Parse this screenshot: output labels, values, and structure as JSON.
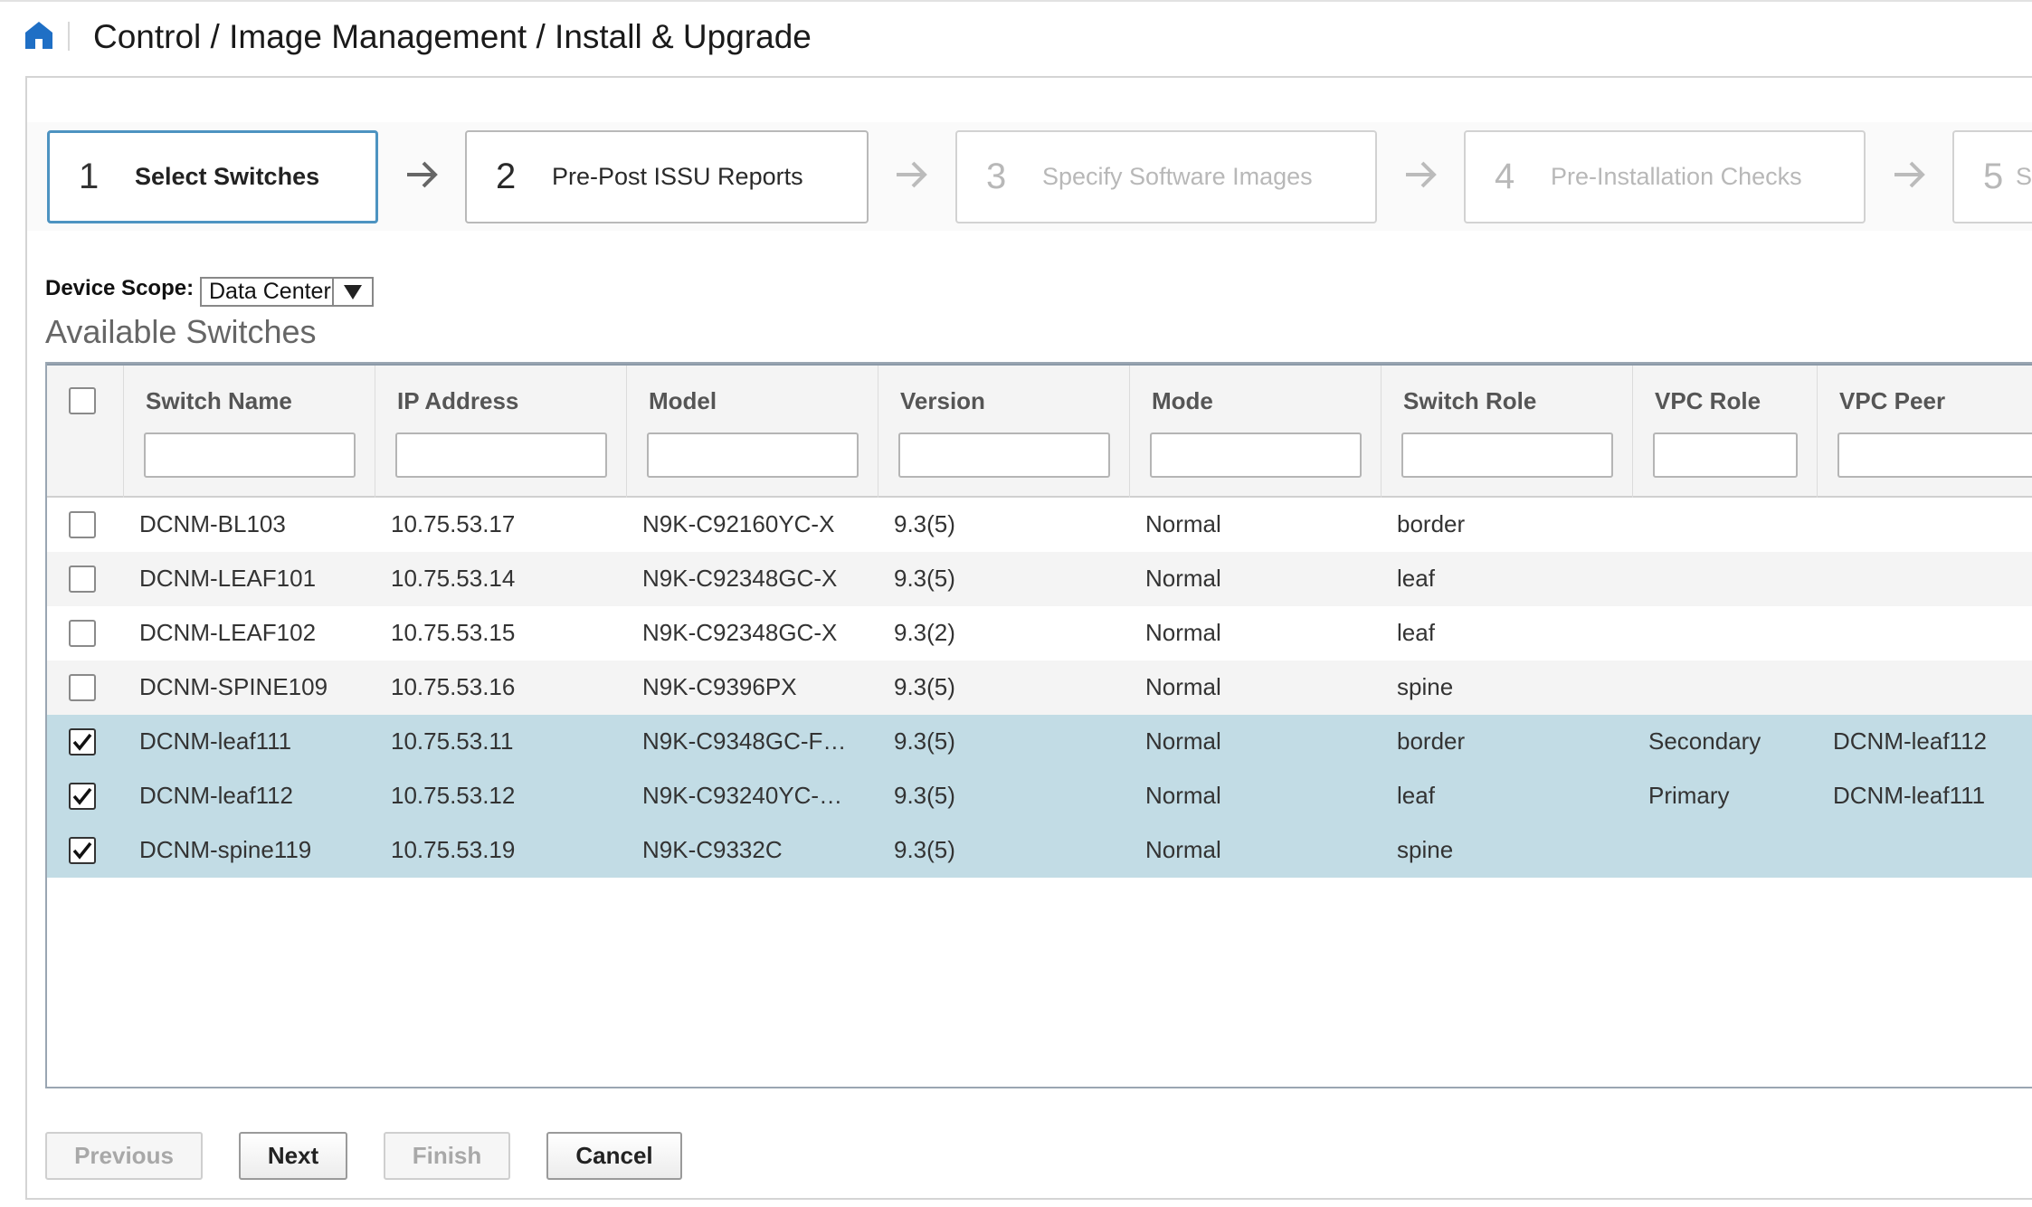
{
  "header": {
    "breadcrumb": "Control / Image Management / Install & Upgrade"
  },
  "wizard": {
    "steps": [
      {
        "num": "1",
        "label": "Select Switches",
        "state": "active"
      },
      {
        "num": "2",
        "label": "Pre-Post ISSU Reports",
        "state": "enabled"
      },
      {
        "num": "3",
        "label": "Specify Software Images",
        "state": "disabled"
      },
      {
        "num": "4",
        "label": "Pre-Installation Checks",
        "state": "disabled"
      },
      {
        "num": "5",
        "label": "S",
        "state": "disabled"
      }
    ]
  },
  "scope": {
    "label": "Device Scope:",
    "value": "Data Center"
  },
  "section_title": "Available Switches",
  "table": {
    "columns": [
      "Switch Name",
      "IP Address",
      "Model",
      "Version",
      "Mode",
      "Switch Role",
      "VPC Role",
      "VPC Peer"
    ],
    "rows": [
      {
        "checked": false,
        "name": "DCNM-BL103",
        "ip": "10.75.53.17",
        "model": "N9K-C92160YC-X",
        "version": "9.3(5)",
        "mode": "Normal",
        "role": "border",
        "vpc_role": "",
        "vpc_peer": ""
      },
      {
        "checked": false,
        "name": "DCNM-LEAF101",
        "ip": "10.75.53.14",
        "model": "N9K-C92348GC-X",
        "version": "9.3(5)",
        "mode": "Normal",
        "role": "leaf",
        "vpc_role": "",
        "vpc_peer": ""
      },
      {
        "checked": false,
        "name": "DCNM-LEAF102",
        "ip": "10.75.53.15",
        "model": "N9K-C92348GC-X",
        "version": "9.3(2)",
        "mode": "Normal",
        "role": "leaf",
        "vpc_role": "",
        "vpc_peer": ""
      },
      {
        "checked": false,
        "name": "DCNM-SPINE109",
        "ip": "10.75.53.16",
        "model": "N9K-C9396PX",
        "version": "9.3(5)",
        "mode": "Normal",
        "role": "spine",
        "vpc_role": "",
        "vpc_peer": ""
      },
      {
        "checked": true,
        "name": "DCNM-leaf111",
        "ip": "10.75.53.11",
        "model": "N9K-C9348GC-F…",
        "version": "9.3(5)",
        "mode": "Normal",
        "role": "border",
        "vpc_role": "Secondary",
        "vpc_peer": "DCNM-leaf112"
      },
      {
        "checked": true,
        "name": "DCNM-leaf112",
        "ip": "10.75.53.12",
        "model": "N9K-C93240YC-…",
        "version": "9.3(5)",
        "mode": "Normal",
        "role": "leaf",
        "vpc_role": "Primary",
        "vpc_peer": "DCNM-leaf111"
      },
      {
        "checked": true,
        "name": "DCNM-spine119",
        "ip": "10.75.53.19",
        "model": "N9K-C9332C",
        "version": "9.3(5)",
        "mode": "Normal",
        "role": "spine",
        "vpc_role": "",
        "vpc_peer": ""
      }
    ]
  },
  "buttons": {
    "previous": "Previous",
    "next": "Next",
    "finish": "Finish",
    "cancel": "Cancel"
  },
  "colors": {
    "selected_row": "#c2dce5",
    "active_step_border": "#4d93c1",
    "home_icon": "#1f6fc5"
  }
}
